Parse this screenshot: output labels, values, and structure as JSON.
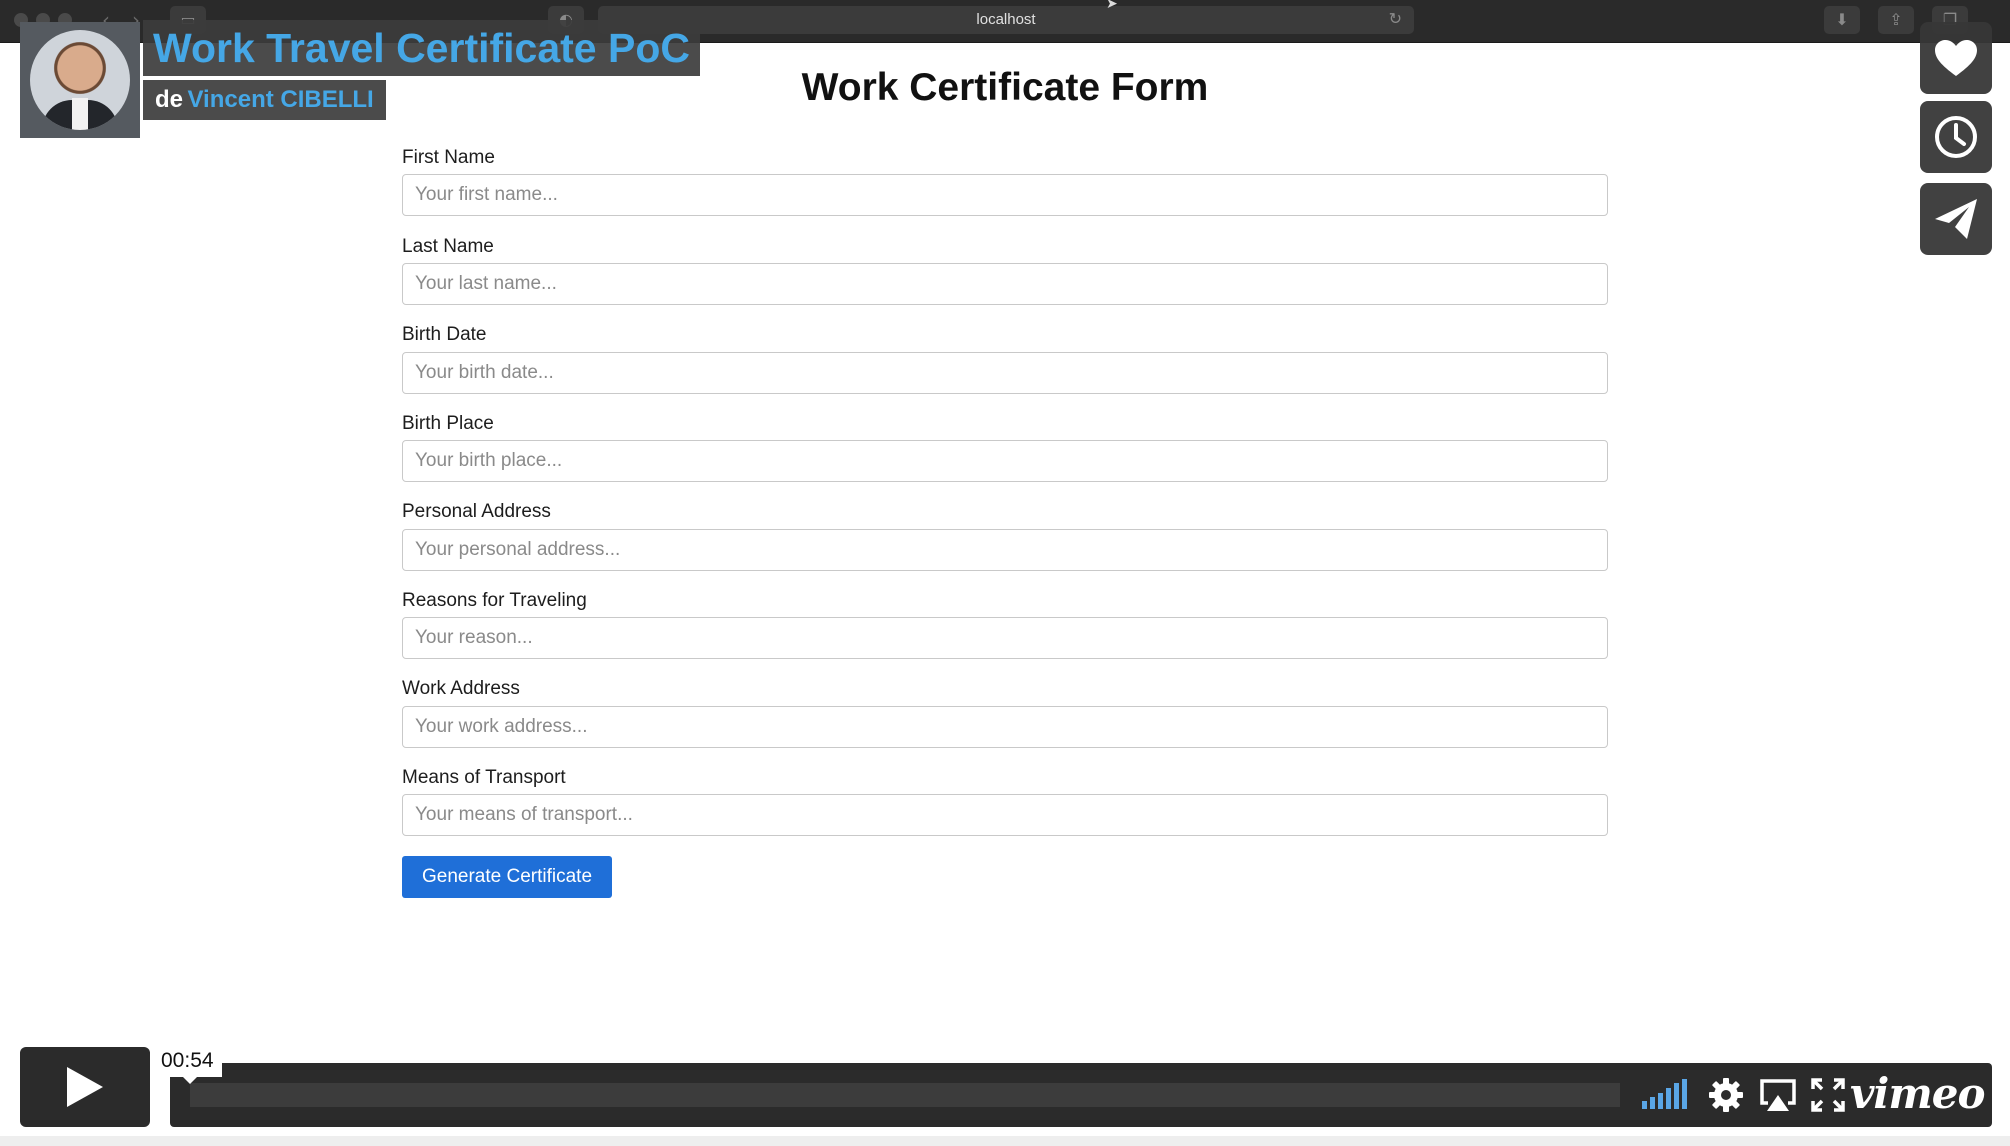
{
  "browser": {
    "url": "localhost"
  },
  "overlay": {
    "video_title": "Work Travel Certificate PoC",
    "byline_prefix": "de",
    "author": "Vincent CIBELLI"
  },
  "form": {
    "title": "Work Certificate Form",
    "fields": [
      {
        "label": "First Name",
        "placeholder": "Your first name..."
      },
      {
        "label": "Last Name",
        "placeholder": "Your last name..."
      },
      {
        "label": "Birth Date",
        "placeholder": "Your birth date..."
      },
      {
        "label": "Birth Place",
        "placeholder": "Your birth place..."
      },
      {
        "label": "Personal Address",
        "placeholder": "Your personal address..."
      },
      {
        "label": "Reasons for Traveling",
        "placeholder": "Your reason..."
      },
      {
        "label": "Work Address",
        "placeholder": "Your work address..."
      },
      {
        "label": "Means of Transport",
        "placeholder": "Your means of transport..."
      }
    ],
    "submit_label": "Generate Certificate"
  },
  "player": {
    "time": "00:54",
    "logo": "vimeo",
    "icons": [
      "play-icon",
      "volume-icon",
      "settings-gear-icon",
      "airplay-icon",
      "fullscreen-icon"
    ],
    "side_icons": [
      "heart-icon",
      "clock-icon",
      "send-icon"
    ]
  },
  "colors": {
    "accent_blue": "#45a7e6",
    "button_blue": "#1f6fd8",
    "chrome_dark": "#2a2a2a"
  }
}
